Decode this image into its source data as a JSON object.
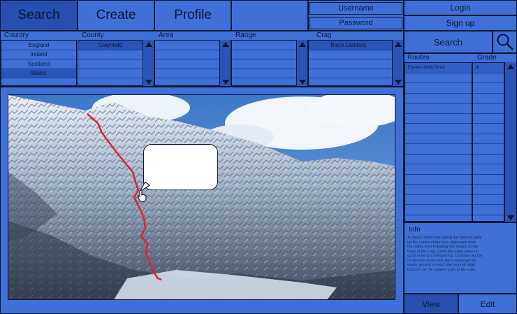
{
  "nav": {
    "search_label": "Search",
    "create_label": "Create",
    "profile_label": "Profile"
  },
  "auth": {
    "username_label": "Username",
    "password_label": "Password",
    "login_label": "Login",
    "signup_label": "Sign up"
  },
  "filters": {
    "country_header": "Country",
    "county_header": "County",
    "area_header": "Area",
    "range_header": "Range",
    "crag_header": "Crag",
    "countries": [
      "England",
      "Ireland",
      "Scotland",
      "Wales"
    ],
    "county_selected": "Gwynedd",
    "crag_selected": "Black Ladders"
  },
  "search_panel": {
    "search_label": "Search"
  },
  "routes": {
    "routes_header": "Routes",
    "grade_header": "Grade",
    "selected_route": "Eastern Gully Direct",
    "selected_grade": "III"
  },
  "info": {
    "header": "Info",
    "lines": [
      "A classic winter line taking the obvious gully",
      "up the centre of the face. Approach from",
      "the valley floor following the stream to the",
      "base of the crag. Climb the initial steps on",
      "good neve to a steepening. Continue via the",
      "icy groove on the left, then trend right on",
      "easier ground to reach the summit ridge.",
      "Descent by the walkers path to the east."
    ]
  },
  "bottom": {
    "view_label": "View",
    "edit_label": "Edit"
  },
  "colors": {
    "panel": "#3f70d8",
    "active": "#264fb0",
    "border": "#0b1630",
    "route_line": "#e02235"
  }
}
